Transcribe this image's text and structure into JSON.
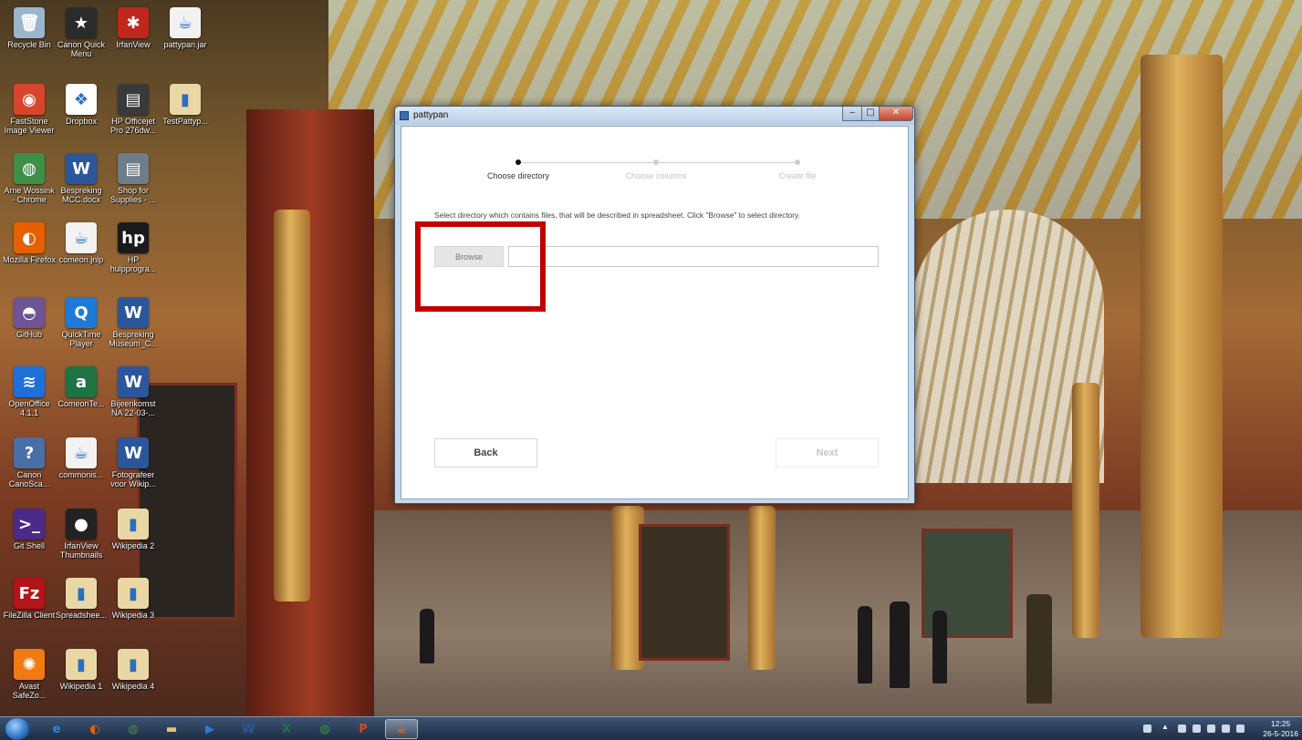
{
  "desktop": {
    "icons": [
      {
        "label": "Recycle Bin",
        "icon": "recycle-bin-icon",
        "color": "#9ab6cc",
        "glyph": "🗑"
      },
      {
        "label": "Canon Quick Menu",
        "icon": "canon-quick-menu-icon",
        "color": "#2b2b2b",
        "glyph": "★"
      },
      {
        "label": "IrfanView",
        "icon": "irfanview-icon",
        "color": "#c0261c",
        "glyph": "✱"
      },
      {
        "label": "pattypan.jar",
        "icon": "java-icon",
        "color": "#f2f2f2",
        "glyph": "☕"
      },
      {
        "label": "FastStone Image Viewer",
        "icon": "faststone-eye-icon",
        "color": "#d8452d",
        "glyph": "◉"
      },
      {
        "label": "Dropbox",
        "icon": "dropbox-icon",
        "color": "#ffffff",
        "glyph": "❖"
      },
      {
        "label": "HP Officejet Pro 276dw...",
        "icon": "printer-icon",
        "color": "#3a3a3a",
        "glyph": "▤"
      },
      {
        "label": "TestPattyp...",
        "icon": "folder-icon",
        "color": "#e9d8a6",
        "glyph": "▮"
      },
      {
        "label": "Arne Wossink - Chrome",
        "icon": "chrome-icon",
        "color": "#3d8f4a",
        "glyph": "◍"
      },
      {
        "label": "Bespreking MCC.docx",
        "icon": "word-document-icon",
        "color": "#2b579a",
        "glyph": "W"
      },
      {
        "label": "Shop for Supplies - ...",
        "icon": "printer-supplies-icon",
        "color": "#6f7c8a",
        "glyph": "▤"
      },
      {
        "label": "Mozilla Firefox",
        "icon": "firefox-icon",
        "color": "#e66000",
        "glyph": "◐"
      },
      {
        "label": "comeon.jnlp",
        "icon": "java-icon",
        "color": "#f2f2f2",
        "glyph": "☕"
      },
      {
        "label": "HP hulpprogra...",
        "icon": "hp-icon",
        "color": "#1a1a1a",
        "glyph": "hp"
      },
      {
        "label": "GitHub",
        "icon": "github-icon",
        "color": "#6e5494",
        "glyph": "◓"
      },
      {
        "label": "QuickTime Player",
        "icon": "quicktime-icon",
        "color": "#1d7ad8",
        "glyph": "Q"
      },
      {
        "label": "Bespreking Museum_C...",
        "icon": "word-document-icon",
        "color": "#2b579a",
        "glyph": "W"
      },
      {
        "label": "OpenOffice 4.1.1",
        "icon": "openoffice-icon",
        "color": "#1e6fd9",
        "glyph": "≋"
      },
      {
        "label": "ComeonTe...",
        "icon": "excel-document-icon",
        "color": "#1f7244",
        "glyph": "a"
      },
      {
        "label": "Bijeenkomst NA 22-03-...",
        "icon": "word-document-icon",
        "color": "#2b579a",
        "glyph": "W"
      },
      {
        "label": "Canon CanoSca...",
        "icon": "canon-scan-icon",
        "color": "#4a6ea8",
        "glyph": "?"
      },
      {
        "label": "commonis...",
        "icon": "java-icon",
        "color": "#f2f2f2",
        "glyph": "☕"
      },
      {
        "label": "Fotografeer voor Wikip...",
        "icon": "word-document-icon",
        "color": "#2b579a",
        "glyph": "W"
      },
      {
        "label": "Git Shell",
        "icon": "git-shell-icon",
        "color": "#4b2a8a",
        "glyph": ">_"
      },
      {
        "label": "IrfanView Thumbnails",
        "icon": "panda-icon",
        "color": "#222222",
        "glyph": "●"
      },
      {
        "label": "Wikipedia 2",
        "icon": "folder-icon",
        "color": "#e9d8a6",
        "glyph": "▮"
      },
      {
        "label": "FileZilla Client",
        "icon": "filezilla-icon",
        "color": "#b3141a",
        "glyph": "Fz"
      },
      {
        "label": "Spreadshee...",
        "icon": "folder-icon",
        "color": "#e9d8a6",
        "glyph": "▮"
      },
      {
        "label": "Wikipedia 3",
        "icon": "folder-icon",
        "color": "#e9d8a6",
        "glyph": "▮"
      },
      {
        "label": "Avast SafeZo...",
        "icon": "avast-icon",
        "color": "#f07b12",
        "glyph": "✺"
      },
      {
        "label": "Wikipedia 1",
        "icon": "folder-icon",
        "color": "#e9d8a6",
        "glyph": "▮"
      },
      {
        "label": "Wikipedia 4",
        "icon": "folder-icon",
        "color": "#e9d8a6",
        "glyph": "▮"
      }
    ]
  },
  "window": {
    "title": "pattypan",
    "controls": {
      "minimize": "‒",
      "maximize": "□",
      "close": "✕"
    },
    "steps": [
      {
        "label": "Choose directory",
        "active": true
      },
      {
        "label": "Choose columns",
        "active": false
      },
      {
        "label": "Create file",
        "active": false
      }
    ],
    "instruction": "Select directory which contains files, that will be described in spreadsheet. Click \"Browse\" to select directory.",
    "browse_label": "Browse",
    "path_value": "",
    "back_label": "Back",
    "next_label": "Next",
    "highlight_color": "#c00000"
  },
  "taskbar": {
    "items": [
      {
        "icon": "internet-explorer-icon",
        "glyph": "e",
        "color": "#1f8fe0"
      },
      {
        "icon": "firefox-icon",
        "glyph": "◐",
        "color": "#e66000"
      },
      {
        "icon": "chrome-icon",
        "glyph": "◍",
        "color": "#3d8f4a"
      },
      {
        "icon": "file-explorer-icon",
        "glyph": "▬",
        "color": "#e8c46a"
      },
      {
        "icon": "media-player-icon",
        "glyph": "▶",
        "color": "#2a7ad6"
      },
      {
        "icon": "word-icon",
        "glyph": "W",
        "color": "#2b579a"
      },
      {
        "icon": "excel-icon",
        "glyph": "X",
        "color": "#1f7244"
      },
      {
        "icon": "chrome-icon",
        "glyph": "◍",
        "color": "#3d8f4a"
      },
      {
        "icon": "powerpoint-icon",
        "glyph": "P",
        "color": "#d24726"
      },
      {
        "icon": "java-icon",
        "glyph": "☕",
        "color": "#e07a2e",
        "active": true
      }
    ],
    "clock_time": "12:25",
    "clock_date": "26-5-2016"
  }
}
